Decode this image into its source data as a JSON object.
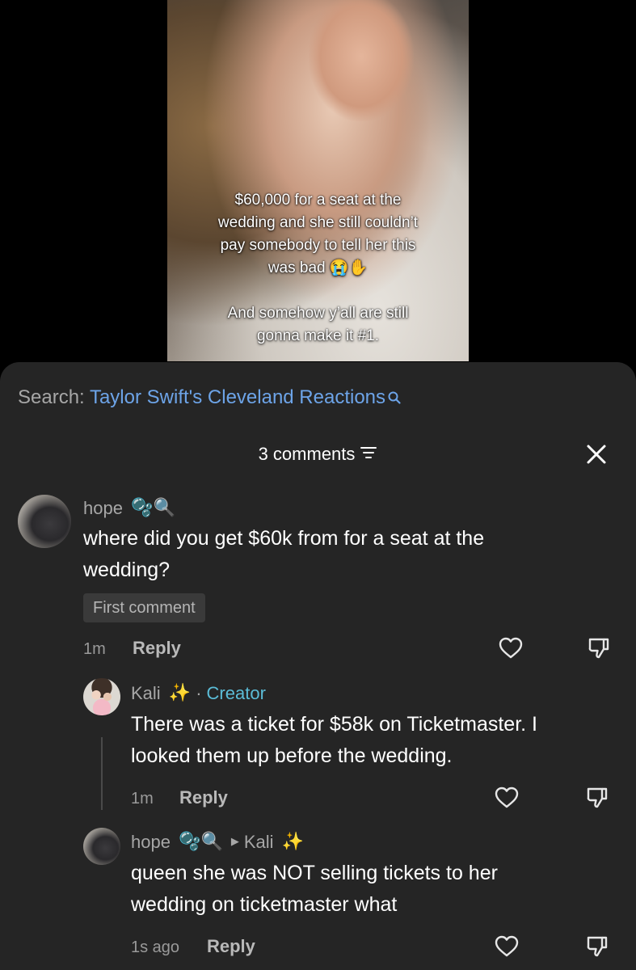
{
  "video": {
    "caption_lines_1": [
      "$60,000 for a seat at the",
      "wedding and she still couldn’t",
      "pay somebody to tell her this",
      "was bad 😭✋"
    ],
    "caption_lines_2": [
      "And somehow y’all are still",
      "gonna make it #1."
    ]
  },
  "search": {
    "prefix": "Search: ",
    "term": "Taylor Swift's Cleveland Reactions",
    "icon": "search-icon"
  },
  "header": {
    "count_label": "3 comments",
    "filter_icon": "filter-icon",
    "close_icon": "close-icon"
  },
  "comments": [
    {
      "username": "hope",
      "badges": "🫧🔍",
      "text_lines": [
        "where did you get $60k from for a seat at the",
        "wedding?"
      ],
      "tag": "First comment",
      "time": "1m",
      "reply_label": "Reply"
    }
  ],
  "replies": [
    {
      "username": "Kali",
      "badges": "✨",
      "separator": "·",
      "creator_label": "Creator",
      "text_lines": [
        "There was a ticket for $58k on Ticketmaster. I",
        "looked them up before the wedding."
      ],
      "time": "1m",
      "reply_label": "Reply"
    },
    {
      "username": "hope",
      "badges": "🫧🔍",
      "reply_to_arrow": "▶",
      "reply_to": "Kali",
      "reply_to_badges": "✨",
      "text_lines": [
        "queen she was NOT selling tickets to her",
        "wedding on ticketmaster what"
      ],
      "time": "1s ago",
      "reply_label": "Reply"
    }
  ],
  "colors": {
    "sheet_bg": "#252525",
    "search_term": "#6da4e8",
    "creator_tag": "#5bbcd7",
    "muted_text": "#a7a7a7"
  }
}
